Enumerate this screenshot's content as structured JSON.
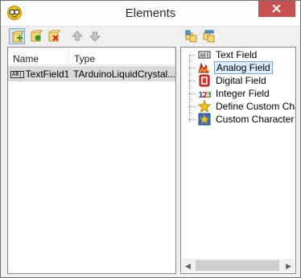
{
  "window": {
    "title": "Elements",
    "icon": "glasses-app-icon",
    "close_icon": "close-icon"
  },
  "left_toolbar": {
    "buttons": [
      {
        "icon": "add-element-icon",
        "pressed": true
      },
      {
        "icon": "add-child-element-icon",
        "pressed": false
      },
      {
        "icon": "delete-element-icon",
        "pressed": false
      },
      {
        "icon": "move-up-icon",
        "pressed": false
      },
      {
        "icon": "move-down-icon",
        "pressed": false
      }
    ]
  },
  "right_toolbar": {
    "buttons": [
      {
        "icon": "expand-all-icon"
      },
      {
        "icon": "collapse-all-icon"
      }
    ]
  },
  "elements_list": {
    "columns": [
      "Name",
      "Type"
    ],
    "rows": [
      {
        "icon": "text-field-icon",
        "name": "TextField1",
        "type": "TArduinoLiquidCrystal..."
      }
    ]
  },
  "palette_tree": {
    "items": [
      {
        "label": "Text Field",
        "icon": "text-field-icon",
        "selected": false
      },
      {
        "label": "Analog Field",
        "icon": "analog-field-icon",
        "selected": true
      },
      {
        "label": "Digital Field",
        "icon": "digital-field-icon",
        "selected": false
      },
      {
        "label": "Integer Field",
        "icon": "integer-field-icon",
        "selected": false
      },
      {
        "label": "Define Custom Chara",
        "icon": "define-custom-character-icon",
        "selected": false
      },
      {
        "label": "Custom Character Fi",
        "icon": "custom-character-field-icon",
        "selected": false
      }
    ]
  },
  "colors": {
    "close_button": "#c7504f",
    "selection": "#dcecfc",
    "row_highlight": "#d9d9d9"
  }
}
